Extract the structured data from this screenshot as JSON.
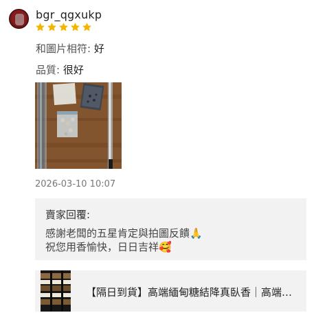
{
  "review": {
    "username": "bgr_qgxukp",
    "rating": 5,
    "star_color": "#f5b400",
    "fields": [
      {
        "label": "和圖片相符:",
        "value": "好"
      },
      {
        "label": "品質:",
        "value": "很好"
      }
    ],
    "timestamp": "2026-03-10 10:07",
    "photo_icon": "product-photo"
  },
  "seller_reply": {
    "title": "賣家回覆:",
    "line1": "感謝老闆的五星肯定與拍圖反饋🙏",
    "line2": "祝您用香愉快，日日吉祥🥰"
  },
  "product": {
    "title": "【隔日到貨】高端緬甸糖結降真臥香｜高端緬甸糖結降真臥香"
  }
}
